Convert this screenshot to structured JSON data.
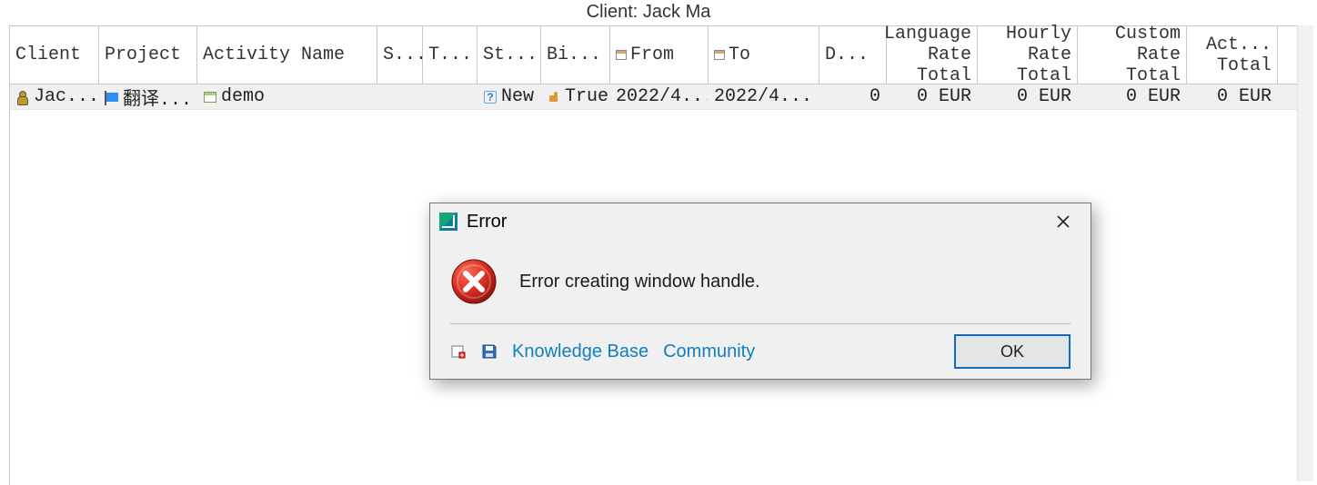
{
  "header": {
    "title": "Client: Jack Ma"
  },
  "grid": {
    "columns": [
      "Client",
      "Project",
      "Activity Name",
      "S...",
      "T...",
      "St...",
      "Bi...",
      "From",
      "To",
      "D...",
      "Language\nRate\nTotal",
      "Hourly\nRate\nTotal",
      "Custom\nRate\nTotal",
      "Act...\nTotal"
    ],
    "rows": [
      {
        "client": "Jac...",
        "project": "翻译...",
        "activity": "demo",
        "s": "",
        "t": "",
        "status": "New",
        "billable": "True",
        "from": "2022/4...",
        "to": "2022/4...",
        "d": "0",
        "lang_total": "0 EUR",
        "hourly_total": "0 EUR",
        "custom_total": "0 EUR",
        "act_total": "0 EUR"
      }
    ]
  },
  "dialog": {
    "title": "Error",
    "message": "Error creating window handle.",
    "links": {
      "kb": "Knowledge Base",
      "community": "Community"
    },
    "ok_label": "OK"
  }
}
